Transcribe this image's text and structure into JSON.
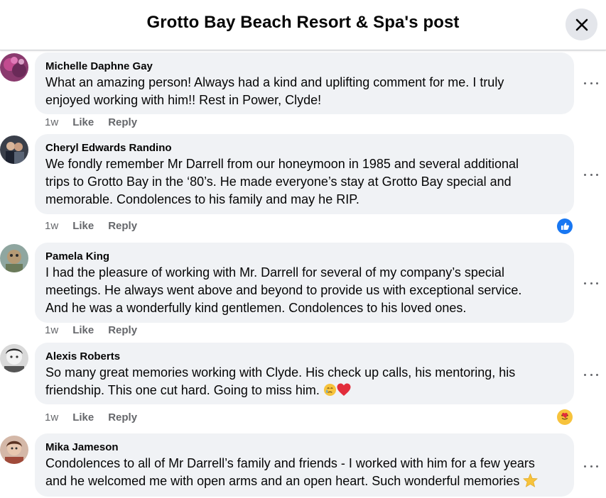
{
  "header": {
    "title": "Grotto Bay Beach Resort & Spa's post",
    "close_icon": "close-icon"
  },
  "comments": [
    {
      "author": "Michelle Daphne Gay",
      "lines": [
        "What an amazing person! Always had a kind and uplifting comment for me. I truly",
        "enjoyed working with him!! Rest in Power, Clyde!"
      ],
      "time": "1w",
      "like": "Like",
      "reply": "Reply",
      "reaction": null
    },
    {
      "author": "Cheryl Edwards Randino",
      "lines": [
        "We fondly remember Mr Darrell from our honeymoon in 1985 and several additional",
        "trips to Grotto Bay in the ‘80’s. He made everyone’s stay at Grotto Bay special and",
        "memorable. Condolences to his family and may he RIP."
      ],
      "time": "1w",
      "like": "Like",
      "reply": "Reply",
      "reaction": "like-reaction-icon"
    },
    {
      "author": "Pamela King",
      "lines": [
        "I had the pleasure of working with Mr. Darrell for several of my company’s special",
        "meetings. He always went above and beyond to provide us with exceptional service.",
        "And he was a wonderfully kind gentlemen. Condolences to his loved ones."
      ],
      "time": "1w",
      "like": "Like",
      "reply": "Reply",
      "reaction": null
    },
    {
      "author": "Alexis Roberts",
      "lines": [
        "So many great memories working with Clyde. His check up calls, his mentoring, his",
        "friendship. This one cut hard. Going to miss him."
      ],
      "trailing_emojis": [
        "crying-face-icon",
        "red-heart-icon"
      ],
      "time": "1w",
      "like": "Like",
      "reply": "Reply",
      "reaction": "care-reaction-icon"
    },
    {
      "author": "Mika Jameson",
      "lines": [
        "Condolences to all of Mr Darrell’s family and friends - I worked with him for a few years",
        "and he welcomed me with open arms and an open heart. Such wonderful memories"
      ],
      "trailing_emojis": [
        "star-icon"
      ],
      "time": null,
      "like": null,
      "reply": null,
      "reaction": null
    }
  ],
  "colors": {
    "bubble": "#f0f2f5",
    "secondary_text": "#65676b",
    "like_blue": "#1877f2",
    "close_bg": "#e4e6eb"
  }
}
